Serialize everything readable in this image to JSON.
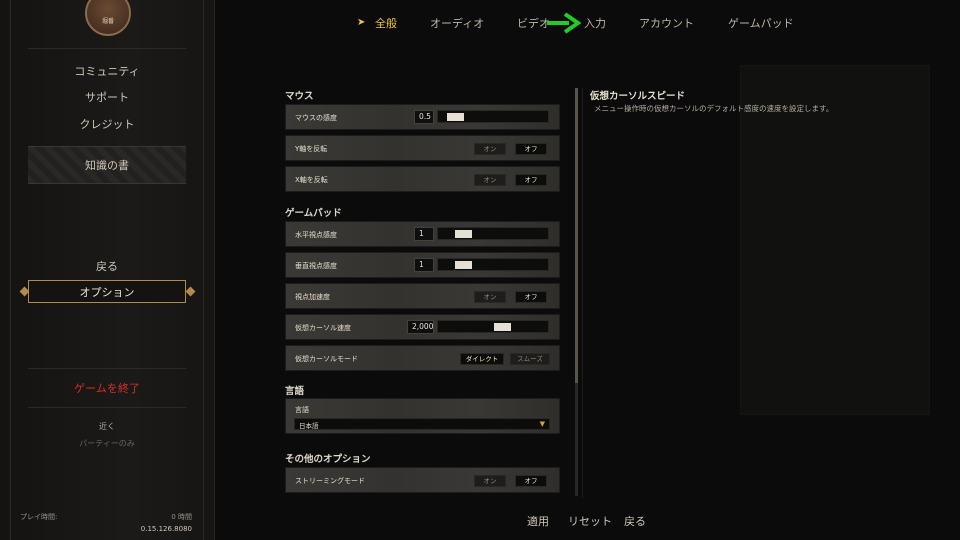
{
  "sidebar": {
    "logo_text": "堀番",
    "items": [
      {
        "label": "コミュニティ"
      },
      {
        "label": "サポート"
      },
      {
        "label": "クレジット"
      }
    ],
    "knowledge": "知識の書",
    "back": "戻る",
    "options": "オプション",
    "quit": "ゲームを終了",
    "nearby": "近く",
    "party_only": "パーティーのみ",
    "playtime_label": "プレイ時間:",
    "playtime_value": "0 時間",
    "version": "0.15.126.8080",
    "quit_color": "#d6302a",
    "accent_color": "#b08a4e"
  },
  "tabs": [
    {
      "label": "全般",
      "active": true
    },
    {
      "label": "オーディオ"
    },
    {
      "label": "ビデオ"
    },
    {
      "label": "入力"
    },
    {
      "label": "アカウント"
    },
    {
      "label": "ゲームパッド"
    }
  ],
  "settings": {
    "mouse_section": "マウス",
    "mouse_sensitivity": {
      "label": "マウスの感度",
      "value": "0.5"
    },
    "invert_y": {
      "label": "Y軸を反転",
      "on": "オン",
      "off": "オフ"
    },
    "invert_x": {
      "label": "X軸を反転",
      "on": "オン",
      "off": "オフ"
    },
    "gamepad_section": "ゲームパッド",
    "horizontal_sens": {
      "label": "水平視点感度",
      "value": "1"
    },
    "vertical_sens": {
      "label": "垂直視点感度",
      "value": "1"
    },
    "view_accel": {
      "label": "視点加速度",
      "on": "オン",
      "off": "オフ"
    },
    "cursor_speed": {
      "label": "仮想カーソル速度",
      "value": "2,000"
    },
    "cursor_mode": {
      "label": "仮想カーソルモード",
      "direct": "ダイレクト",
      "smooth": "スムーズ"
    },
    "language_section": "言語",
    "language": {
      "label": "言語",
      "value": "日本語"
    },
    "other_section": "その他のオプション",
    "streaming": {
      "label": "ストリーミングモード",
      "on": "オン",
      "off": "オフ"
    }
  },
  "description": {
    "title": "仮想カーソルスピード",
    "text": "メニュー操作時の仮想カーソルのデフォルト感度の速度を設定します。"
  },
  "bottom": {
    "apply": "適用",
    "reset": "リセット",
    "back": "戻る"
  },
  "colors": {
    "active_tab": "#f0c24a",
    "annotation_arrow": "#22cc22"
  }
}
